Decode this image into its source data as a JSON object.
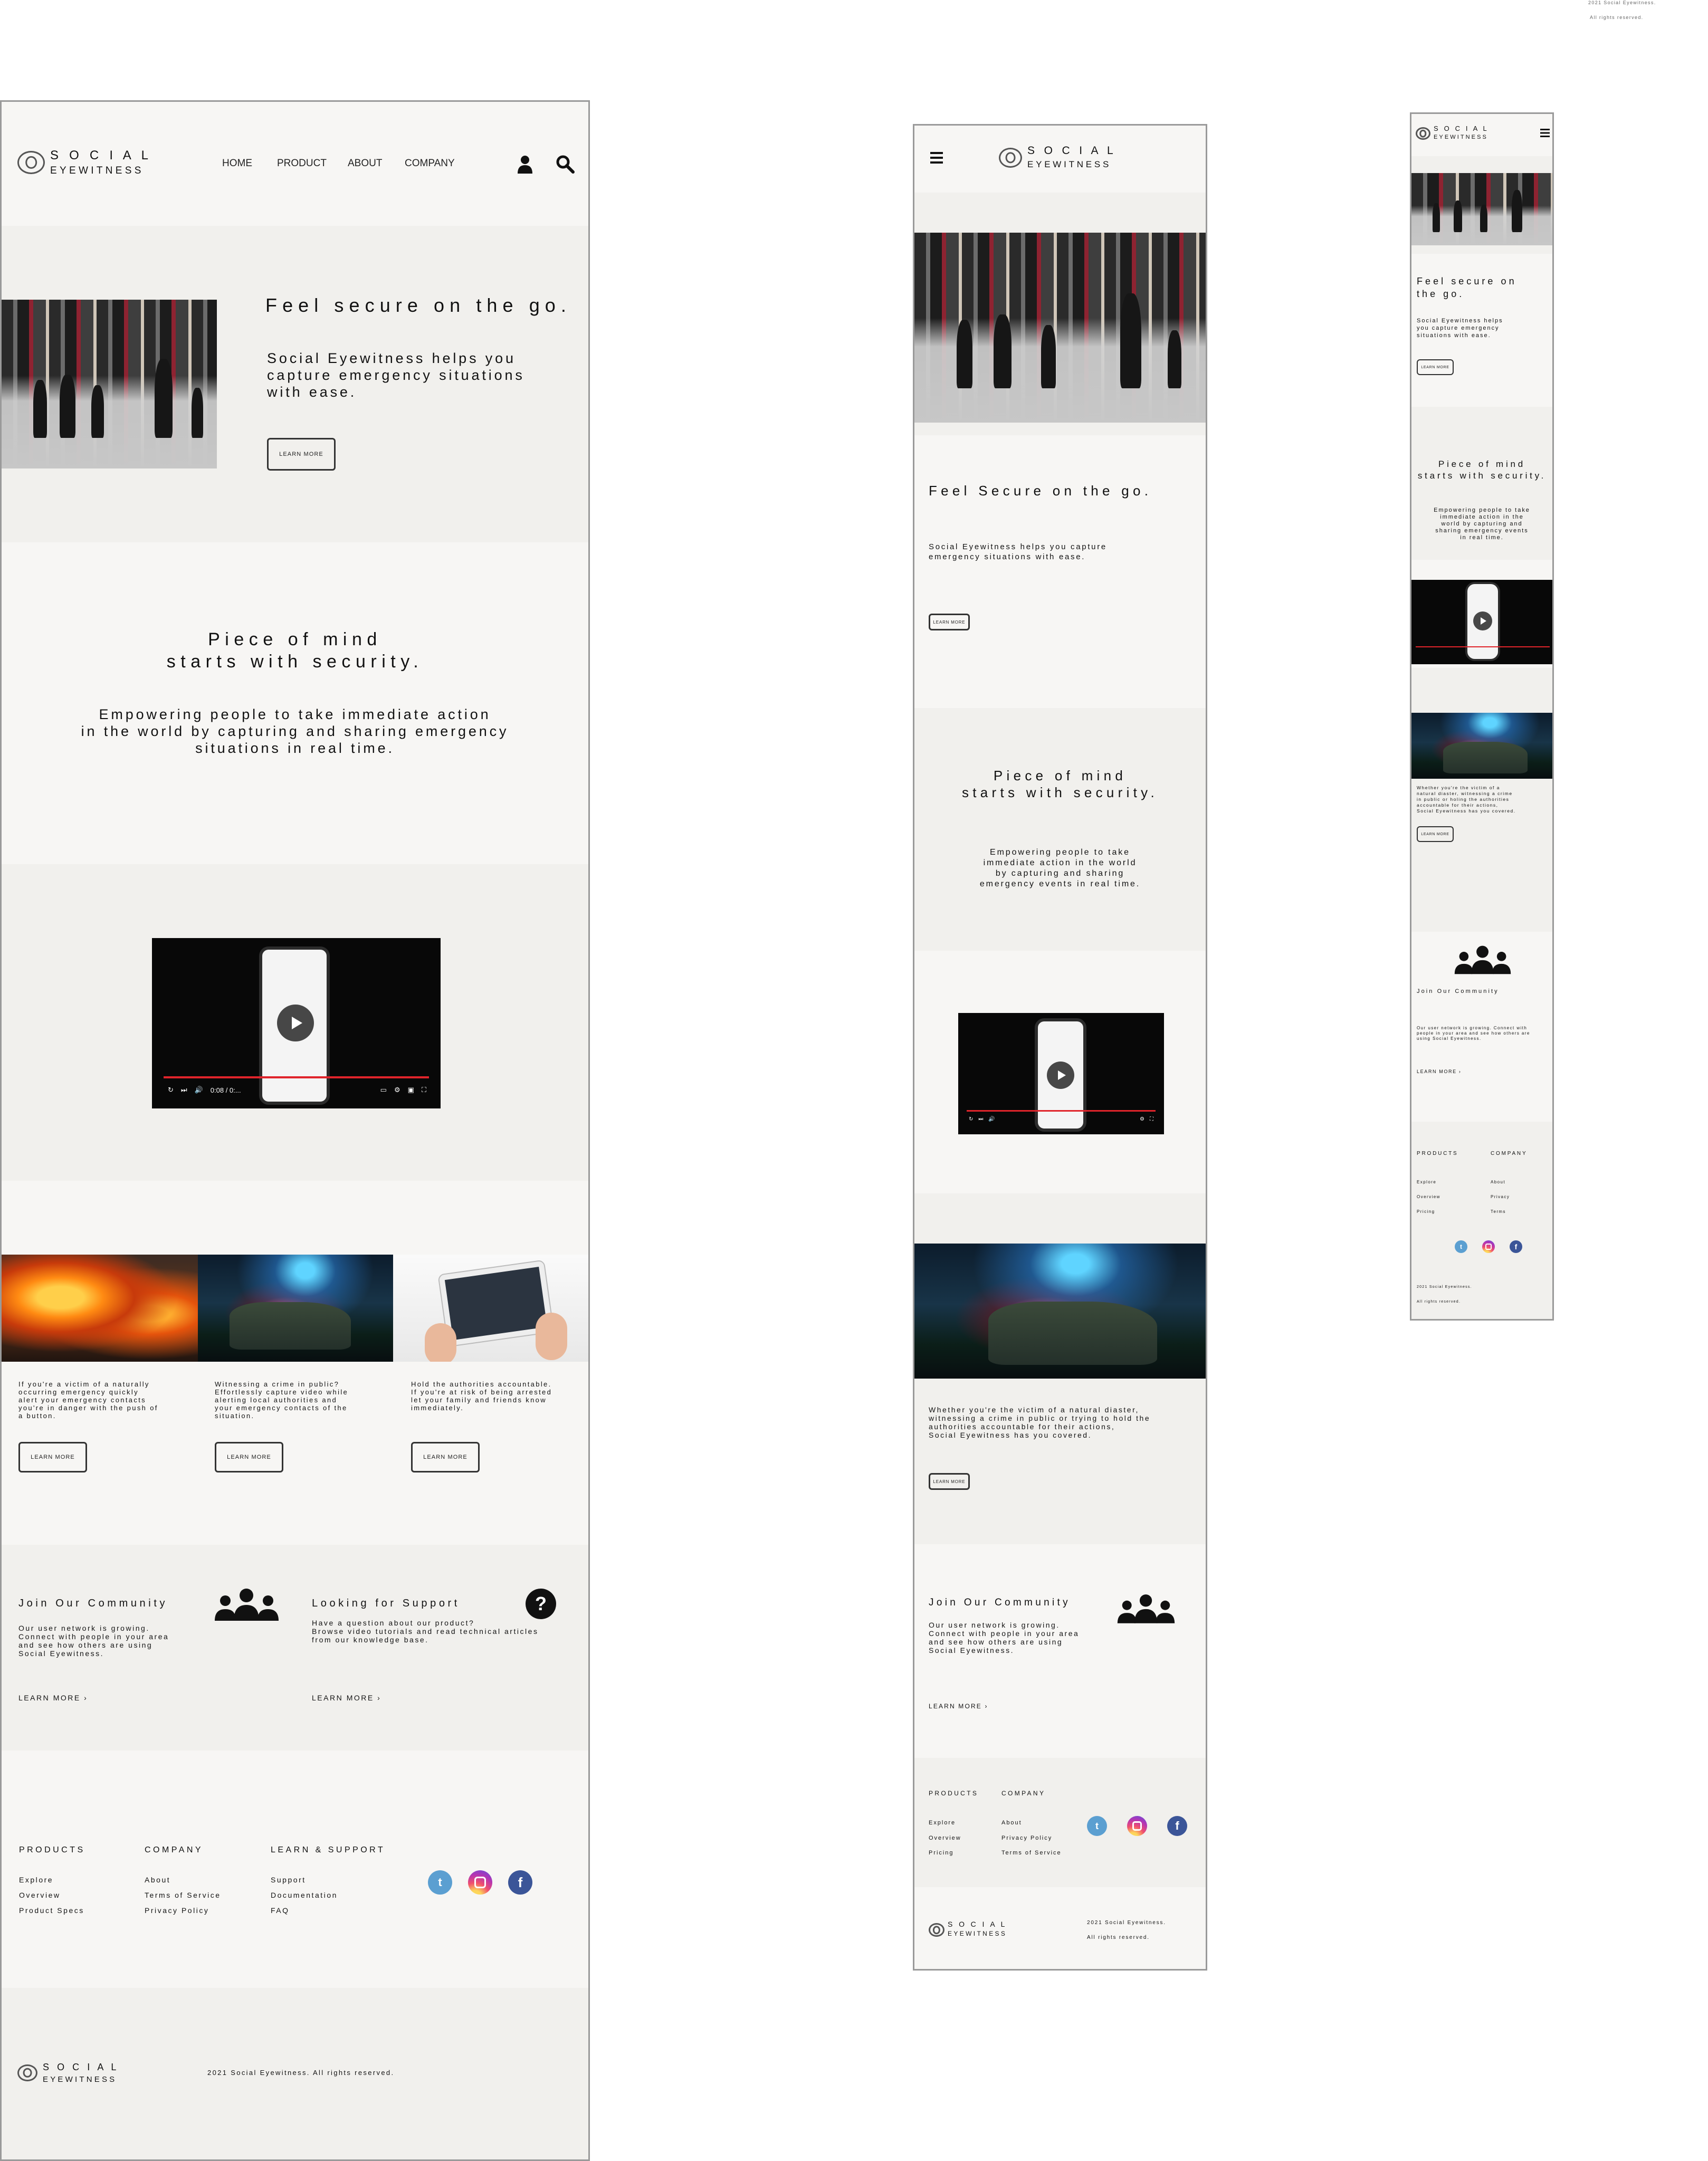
{
  "brand": {
    "line1": "S O C I A L",
    "line2": "EYEWITNESS"
  },
  "corner_copyright": {
    "line1": "2021 Social Eyewitness.",
    "line2": "All rights reserved."
  },
  "desktop": {
    "nav": [
      "HOME",
      "PRODUCT",
      "ABOUT",
      "COMPANY"
    ],
    "hero": {
      "title": "Feel secure on the go.",
      "body": "Social Eyewitness helps you\ncapture emergency situations\nwith ease.",
      "button": "LEARN MORE"
    },
    "mission": {
      "title": "Piece of mind\nstarts with security.",
      "body": "Empowering people to take immediate action\nin the world by capturing and sharing emergency\nsituations in real time."
    },
    "video": {
      "time": "0:08 / 0:..."
    },
    "cards": [
      {
        "text": "If you're a victim of a naturally\noccurring emergency quickly\nalert your emergency contacts\nyou're in danger with the push of\na button.",
        "button": "LEARN MORE"
      },
      {
        "text": "Witnessing a crime in public?\nEffortlessly capture video while\nalerting local authorities and\nyour emergency contacts of the\nsituation.",
        "button": "LEARN MORE"
      },
      {
        "text": "Hold the authorities accountable.\nIf you're at risk of being arrested\nlet your family and friends know\nimmediately.",
        "button": "LEARN MORE"
      }
    ],
    "community": {
      "title": "Join Our Community",
      "body": "Our user network is growing.\nConnect with people in your area\nand see how others are using\nSocial Eyewitness.",
      "link": "LEARN MORE  ›"
    },
    "support": {
      "title": "Looking for Support",
      "body": "Have a question about our product?\nBrowse video tutorials and read technical articles\nfrom our knowledge base.",
      "link": "LEARN MORE  ›"
    },
    "footer": {
      "cols": [
        {
          "head": "PRODUCTS",
          "items": [
            "Explore",
            "Overview",
            "Product Specs"
          ]
        },
        {
          "head": "COMPANY",
          "items": [
            "About",
            "Terms of Service",
            "Privacy Policy"
          ]
        },
        {
          "head": "LEARN & SUPPORT",
          "items": [
            "Support",
            "Documentation",
            "FAQ"
          ]
        }
      ],
      "copyright": "2021 Social Eyewitness. All rights reserved."
    }
  },
  "tablet": {
    "hero": {
      "title": "Feel Secure on the go.",
      "body": "Social Eyewitness helps you capture\nemergency situations with ease.",
      "button": "LEARN MORE"
    },
    "mission": {
      "title": "Piece of mind\nstarts with security.",
      "body": "Empowering people to take\nimmediate action in the world\nby capturing and sharing\nemergency events in real time."
    },
    "crime": {
      "text": "Whether you're the victim of a natural diaster,\nwitnessing a crime in public or trying to hold the\nauthorities accountable for their actions,\nSocial Eyewitness has you covered.",
      "button": "LEARN MORE"
    },
    "community": {
      "title": "Join Our Community",
      "body": "Our user network is growing.\nConnect with people in your area\nand see how others are using\nSocial Eyewitness.",
      "link": "LEARN MORE  ›"
    },
    "footer": {
      "cols": [
        {
          "head": "PRODUCTS",
          "items": [
            "Explore",
            "Overview",
            "Pricing"
          ]
        },
        {
          "head": "COMPANY",
          "items": [
            "About",
            "Privacy Policy",
            "Terms of Service"
          ]
        }
      ],
      "copy1": "2021 Social Eyewitness.",
      "copy2": "All rights reserved."
    }
  },
  "mobile": {
    "hero": {
      "title": "Feel secure on\nthe go.",
      "body": "Social Eyewitness helps\nyou capture emergency\nsituations with ease.",
      "button": "LEARN MORE"
    },
    "mission": {
      "title": "Piece of mind\nstarts with security.",
      "body": "Empowering people to take\nimmediate action in the\nworld by capturing and\nsharing emergency events\nin real time."
    },
    "crime": {
      "text": "Whether you're the victim of a\nnatural diaster, witnessing a crime\nin public or holing the authorities\naccountable for their actions,\nSocial Eyewitness has you covered.",
      "button": "LEARN MORE"
    },
    "community": {
      "title": "Join Our Community",
      "body": "Our user network is growing. Connect with\npeople in your area and see how others are\nusing Social Eyewitness.",
      "link": "LEARN MORE  ›"
    },
    "footer": {
      "cols": [
        {
          "head": "PRODUCTS",
          "items": [
            "Explore",
            "Overview",
            "Pricing"
          ]
        },
        {
          "head": "COMPANY",
          "items": [
            "About",
            "Privacy",
            "Terms"
          ]
        }
      ],
      "copy1": "2021 Social Eyewitness.",
      "copy2": "All rights reserved."
    }
  },
  "icons": {
    "twitter": "twitter-icon",
    "instagram": "instagram-icon",
    "facebook": "facebook-icon",
    "user": "user-icon",
    "search": "search-icon",
    "menu": "menu-icon",
    "help": "help-icon",
    "group": "group-icon"
  }
}
